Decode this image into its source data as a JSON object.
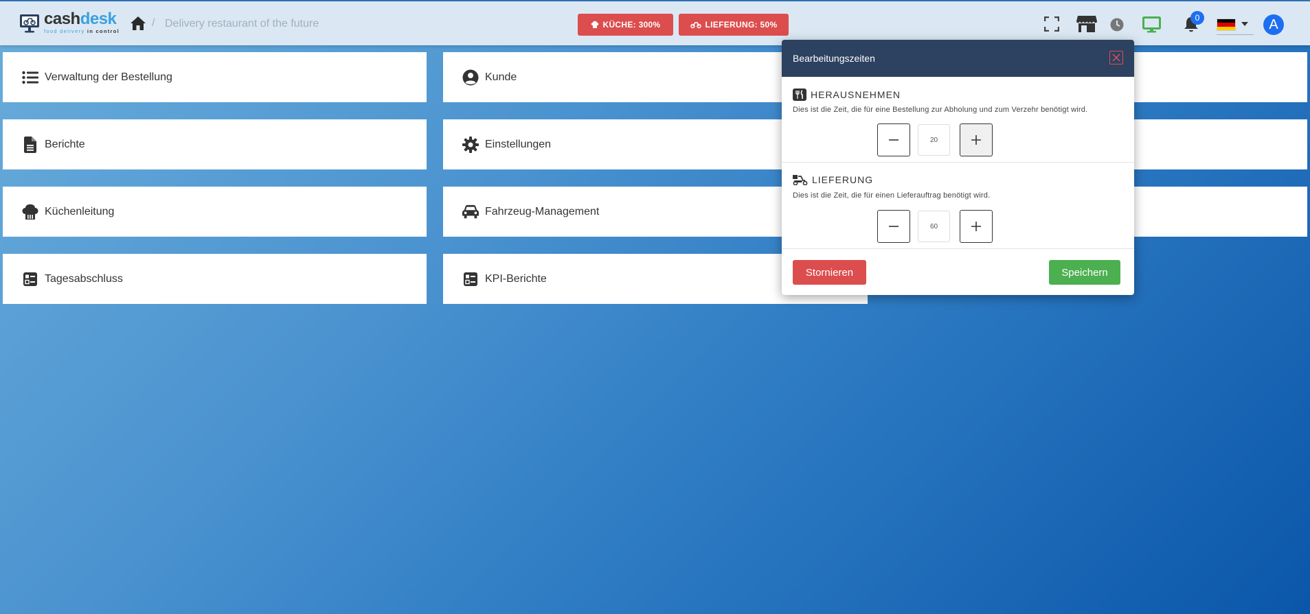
{
  "app": {
    "logo_main_1": "cash",
    "logo_main_2": "desk",
    "logo_sub_1": "food delivery ",
    "logo_sub_2": "in control",
    "breadcrumb_sep": "/",
    "breadcrumb_text": "Delivery restaurant of the future"
  },
  "header": {
    "kitchen_status": "KÜCHE: 300%",
    "delivery_status": "LIEFERUNG: 50%",
    "notification_count": "0",
    "avatar_letter": "A",
    "status_color": "#dc4d4d",
    "accent_color": "#1e6ff0",
    "monitor_color": "#4caf50"
  },
  "menu": {
    "items": [
      {
        "label": "Verwaltung der Bestellung",
        "icon": "list-icon"
      },
      {
        "label": "Kunde",
        "icon": "user-circle-icon"
      },
      {
        "label": "Berichte",
        "icon": "document-icon"
      },
      {
        "label": "Einstellungen",
        "icon": "gear-icon"
      },
      {
        "label": "Küchenleitung",
        "icon": "chef-hat-icon"
      },
      {
        "label": "Fahrzeug-Management",
        "icon": "car-icon"
      },
      {
        "label": "Tagesabschluss",
        "icon": "checklist-icon"
      },
      {
        "label": "KPI-Berichte",
        "icon": "checklist-icon"
      }
    ]
  },
  "modal": {
    "title": "Bearbeitungszeiten",
    "takeaway": {
      "title": "HERAUSNEHMEN",
      "description": "Dies ist die Zeit, die für eine Bestellung zur Abholung und zum Verzehr benötigt wird.",
      "value": "20"
    },
    "delivery": {
      "title": "LIEFERUNG",
      "description": "Dies ist die Zeit, die für einen Lieferauftrag benötigt wird.",
      "value": "60"
    },
    "cancel_label": "Stornieren",
    "save_label": "Speichern"
  }
}
